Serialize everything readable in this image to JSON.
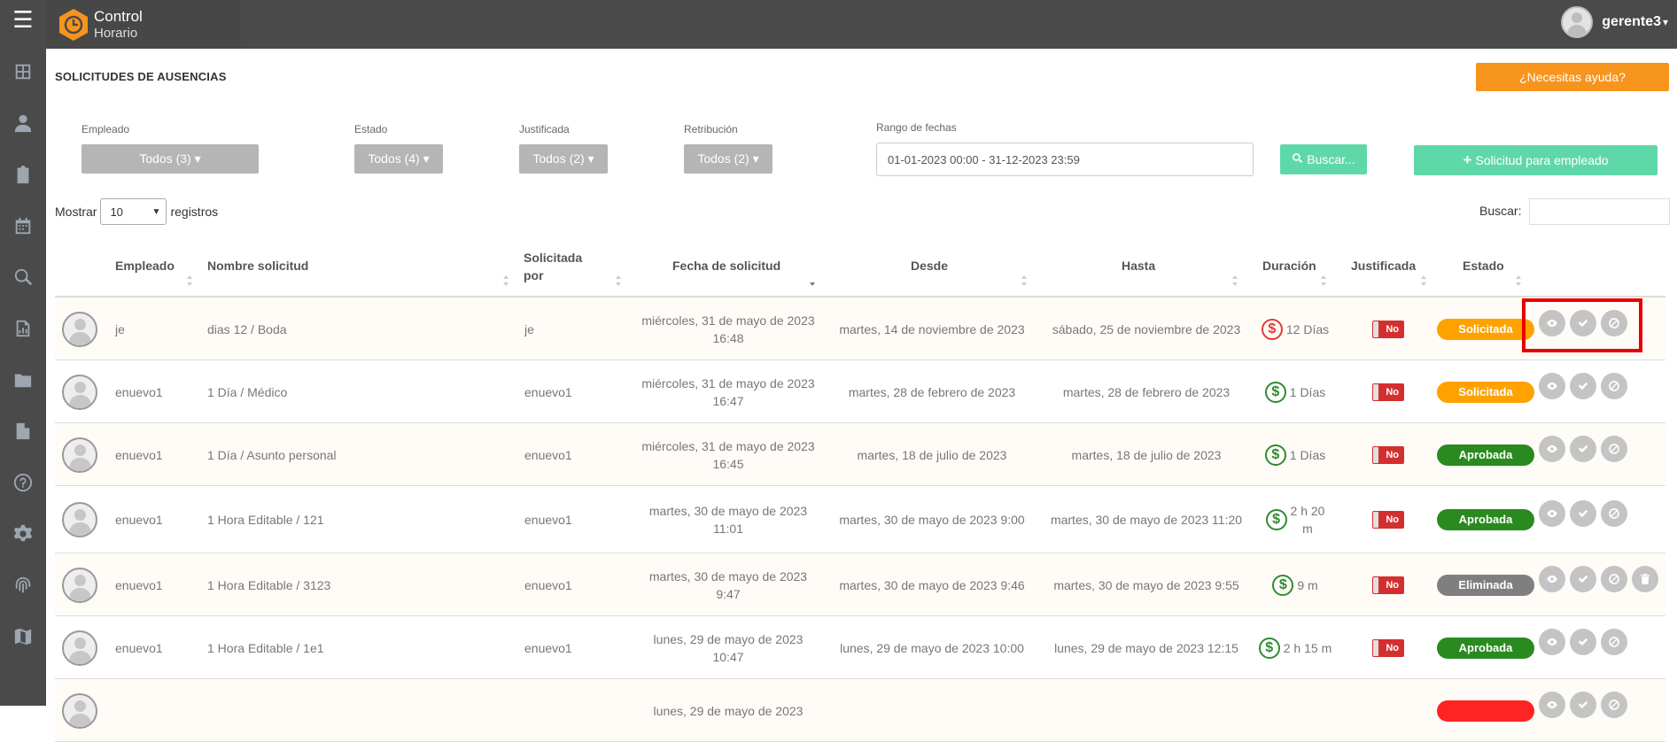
{
  "app": {
    "brand_line1": "Control",
    "brand_line2": "Horario",
    "user_name": "gerente3",
    "user_caret": "▾"
  },
  "sidebar_icons": [
    "dashboard-icon",
    "user-icon",
    "clipboard-icon",
    "calendar-icon",
    "search-icon",
    "report-icon",
    "folder-icon",
    "building-icon",
    "help-icon",
    "gear-icon",
    "fingerprint-icon",
    "map-icon"
  ],
  "page": {
    "title": "SOLICITUDES DE AUSENCIAS",
    "help_button": "¿Necesitas ayuda?"
  },
  "filters": {
    "empleado_label": "Empleado",
    "empleado_value": "Todos (3) ▾",
    "estado_label": "Estado",
    "estado_value": "Todos (4) ▾",
    "justificada_label": "Justificada",
    "justificada_value": "Todos (2) ▾",
    "retribucion_label": "Retribución",
    "retribucion_value": "Todos (2) ▾",
    "rango_label": "Rango de fechas",
    "rango_value": "01-01-2023 00:00 - 31-12-2023 23:59",
    "search_button": "Buscar...",
    "new_request_button": "Solicitud para empleado"
  },
  "table_controls": {
    "show_label": "Mostrar",
    "show_value": "10",
    "records_label": "registros",
    "search_label": "Buscar:"
  },
  "columns": {
    "empleado": "Empleado",
    "nombre": "Nombre solicitud",
    "solicitada_1": "Solicitada",
    "solicitada_2": "por",
    "fecha": "Fecha de solicitud",
    "desde": "Desde",
    "hasta": "Hasta",
    "duracion": "Duración",
    "justificada": "Justificada",
    "estado": "Estado"
  },
  "colors": {
    "solicitada": "#ffa200",
    "aprobada": "#2a8a1f",
    "eliminada": "#7f7f7f",
    "denegada": "#ff2424"
  },
  "rows": [
    {
      "empleado": "je",
      "nombre": "dias 12 / Boda",
      "por": "je",
      "fecha1": "miércoles, 31 de mayo de 2023",
      "fecha2": "16:48",
      "desde": "martes, 14 de noviembre de 2023",
      "hasta": "sábado, 25 de noviembre de 2023",
      "duracion1": "12 Días",
      "duracion2": "",
      "paid": false,
      "justificada": "No",
      "estado": "Solicitada",
      "status": "solicitada",
      "trash": false
    },
    {
      "empleado": "enuevo1",
      "nombre": "1 Día / Médico",
      "por": "enuevo1",
      "fecha1": "miércoles, 31 de mayo de 2023",
      "fecha2": "16:47",
      "desde": "martes, 28 de febrero de 2023",
      "hasta": "martes, 28 de febrero de 2023",
      "duracion1": "1 Días",
      "duracion2": "",
      "paid": true,
      "justificada": "No",
      "estado": "Solicitada",
      "status": "solicitada",
      "trash": false
    },
    {
      "empleado": "enuevo1",
      "nombre": "1 Día / Asunto personal",
      "por": "enuevo1",
      "fecha1": "miércoles, 31 de mayo de 2023",
      "fecha2": "16:45",
      "desde": "martes, 18 de julio de 2023",
      "hasta": "martes, 18 de julio de 2023",
      "duracion1": "1 Días",
      "duracion2": "",
      "paid": true,
      "justificada": "No",
      "estado": "Aprobada",
      "status": "aprobada",
      "trash": false
    },
    {
      "empleado": "enuevo1",
      "nombre": "1 Hora Editable / 121",
      "por": "enuevo1",
      "fecha1": "martes, 30 de mayo de 2023",
      "fecha2": "11:01",
      "desde": "martes, 30 de mayo de 2023 9:00",
      "hasta": "martes, 30 de mayo de 2023 11:20",
      "duracion1": "2 h 20",
      "duracion2": "m",
      "paid": true,
      "justificada": "No",
      "estado": "Aprobada",
      "status": "aprobada",
      "trash": false
    },
    {
      "empleado": "enuevo1",
      "nombre": "1 Hora Editable / 3123",
      "por": "enuevo1",
      "fecha1": "martes, 30 de mayo de 2023",
      "fecha2": "9:47",
      "desde": "martes, 30 de mayo de 2023 9:46",
      "hasta": "martes, 30 de mayo de 2023 9:55",
      "duracion1": "9 m",
      "duracion2": "",
      "paid": true,
      "justificada": "No",
      "estado": "Eliminada",
      "status": "eliminada",
      "trash": true
    },
    {
      "empleado": "enuevo1",
      "nombre": "1 Hora Editable / 1e1",
      "por": "enuevo1",
      "fecha1": "lunes, 29 de mayo de 2023",
      "fecha2": "10:47",
      "desde": "lunes, 29 de mayo de 2023 10:00",
      "hasta": "lunes, 29 de mayo de 2023 12:15",
      "duracion1": "2 h 15 m",
      "duracion2": "",
      "paid": true,
      "justificada": "No",
      "estado": "Aprobada",
      "status": "aprobada",
      "trash": false
    },
    {
      "empleado": "",
      "nombre": "",
      "por": "",
      "fecha1": "lunes, 29 de mayo de 2023",
      "fecha2": "",
      "desde": "",
      "hasta": "",
      "duracion1": "",
      "duracion2": "",
      "paid": true,
      "justificada": "",
      "estado": "",
      "status": "denegada",
      "trash": false
    }
  ]
}
